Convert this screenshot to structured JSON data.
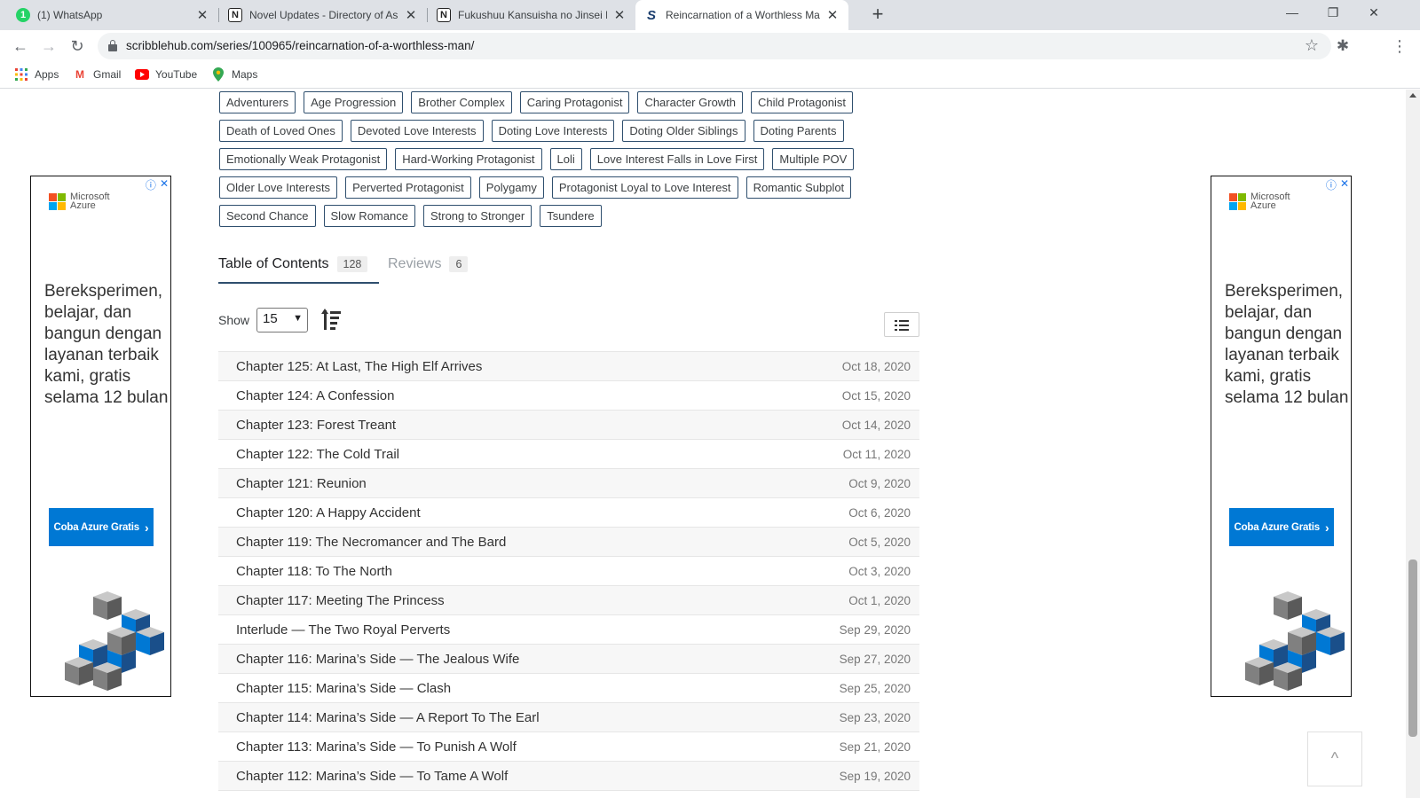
{
  "browser": {
    "tabs": [
      {
        "title": "(1) WhatsApp",
        "favicon": "whatsapp-icon"
      },
      {
        "title": "Novel Updates - Directory of Asia",
        "favicon": "novelupdates-icon"
      },
      {
        "title": "Fukushuu Kansuisha no Jinsei Nii",
        "favicon": "novelupdates-icon"
      },
      {
        "title": "Reincarnation of a Worthless Man",
        "favicon": "scribblehub-icon",
        "active": true
      }
    ],
    "new_tab": "+",
    "url": "scribblehub.com/series/100965/reincarnation-of-a-worthless-man/",
    "bookmarks": [
      {
        "label": "Apps",
        "icon": "apps-grid-icon"
      },
      {
        "label": "Gmail",
        "icon": "gmail-icon"
      },
      {
        "label": "YouTube",
        "icon": "youtube-icon"
      },
      {
        "label": "Maps",
        "icon": "maps-pin-icon"
      }
    ]
  },
  "tags": [
    [
      "Adventurers",
      "Age Progression",
      "Brother Complex",
      "Caring Protagonist",
      "Character Growth",
      "Child Protagonist"
    ],
    [
      "Death of Loved Ones",
      "Devoted Love Interests",
      "Doting Love Interests",
      "Doting Older Siblings",
      "Doting Parents"
    ],
    [
      "Emotionally Weak Protagonist",
      "Hard-Working Protagonist",
      "Loli",
      "Love Interest Falls in Love First",
      "Multiple POV"
    ],
    [
      "Older Love Interests",
      "Perverted Protagonist",
      "Polygamy",
      "Protagonist Loyal to Love Interest",
      "Romantic Subplot"
    ],
    [
      "Second Chance",
      "Slow Romance",
      "Strong to Stronger",
      "Tsundere"
    ]
  ],
  "toc_tabs": {
    "contents_label": "Table of Contents",
    "contents_count": "128",
    "reviews_label": "Reviews",
    "reviews_count": "6"
  },
  "show": {
    "label": "Show",
    "value": "15"
  },
  "chapters": [
    {
      "title": "Chapter 125: At Last, The High Elf Arrives",
      "date": "Oct 18, 2020"
    },
    {
      "title": "Chapter 124: A Confession",
      "date": "Oct 15, 2020"
    },
    {
      "title": "Chapter 123: Forest Treant",
      "date": "Oct 14, 2020"
    },
    {
      "title": "Chapter 122: The Cold Trail",
      "date": "Oct 11, 2020"
    },
    {
      "title": "Chapter 121: Reunion",
      "date": "Oct 9, 2020"
    },
    {
      "title": "Chapter 120: A Happy Accident",
      "date": "Oct 6, 2020"
    },
    {
      "title": "Chapter 119: The Necromancer and The Bard",
      "date": "Oct 5, 2020"
    },
    {
      "title": "Chapter 118: To The North",
      "date": "Oct 3, 2020"
    },
    {
      "title": "Chapter 117: Meeting The Princess",
      "date": "Oct 1, 2020"
    },
    {
      "title": "Interlude — The Two Royal Perverts",
      "date": "Sep 29, 2020"
    },
    {
      "title": "Chapter 116: Marina’s Side — The Jealous Wife",
      "date": "Sep 27, 2020"
    },
    {
      "title": "Chapter 115: Marina’s Side — Clash",
      "date": "Sep 25, 2020"
    },
    {
      "title": "Chapter 114: Marina’s Side — A Report To The Earl",
      "date": "Sep 23, 2020"
    },
    {
      "title": "Chapter 113: Marina’s Side — To Punish A Wolf",
      "date": "Sep 21, 2020"
    },
    {
      "title": "Chapter 112: Marina’s Side — To Tame A Wolf",
      "date": "Sep 19, 2020"
    }
  ],
  "ads": {
    "brand_line1": "Microsoft",
    "brand_line2": "Azure",
    "headline": "Bereksperimen, belajar, dan bangun dengan layanan terbaik kami, gratis selama 12 bulan",
    "cta": "Coba Azure Gratis",
    "accent": "#0078d4"
  },
  "back_to_top": "^"
}
